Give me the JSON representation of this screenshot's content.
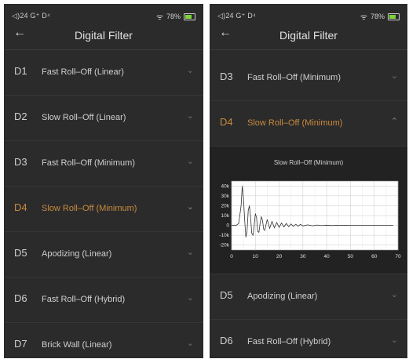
{
  "status": {
    "signal": "◁)24 G⁺ D⁴",
    "wifi_icon": "wifi-icon",
    "battery": "78%"
  },
  "header": {
    "back_icon": "←",
    "title": "Digital Filter"
  },
  "left_list": [
    {
      "code": "D1",
      "label": "Fast Roll–Off (Linear)",
      "active": false
    },
    {
      "code": "D2",
      "label": "Slow Roll–Off (Linear)",
      "active": false
    },
    {
      "code": "D3",
      "label": "Fast Roll–Off (Minimum)",
      "active": false
    },
    {
      "code": "D4",
      "label": "Slow Roll–Off (Minimum)",
      "active": true
    },
    {
      "code": "D5",
      "label": "Apodizing (Linear)",
      "active": false
    },
    {
      "code": "D6",
      "label": "Fast Roll–Off (Hybrid)",
      "active": false
    },
    {
      "code": "D7",
      "label": "Brick Wall (Linear)",
      "active": false
    }
  ],
  "right_list_top": [
    {
      "code": "D3",
      "label": "Fast Roll–Off (Minimum)",
      "active": false
    },
    {
      "code": "D4",
      "label": "Slow Roll–Off (Minimum)",
      "active": true
    }
  ],
  "right_list_bottom": [
    {
      "code": "D5",
      "label": "Apodizing (Linear)",
      "active": false
    },
    {
      "code": "D6",
      "label": "Fast Roll–Off (Hybrid)",
      "active": false
    }
  ],
  "chevrons": {
    "down": "⌄",
    "up": "⌃"
  },
  "chart_data": {
    "type": "line",
    "title": "Slow Roll–Off (Minimum)",
    "xlabel": "",
    "ylabel": "",
    "xlim": [
      0,
      70
    ],
    "ylim": [
      -25000,
      45000
    ],
    "xticks": [
      0,
      10,
      20,
      30,
      40,
      50,
      60,
      70
    ],
    "xtick_labels": [
      "0",
      "10",
      "20",
      "30",
      "40",
      "50",
      "60",
      "70"
    ],
    "yticks": [
      40000,
      30000,
      20000,
      10000,
      0,
      -10000,
      -20000
    ],
    "ytick_labels": [
      "40k",
      "30k",
      "20k",
      "10k",
      "0",
      "-10k",
      "-20k"
    ],
    "grid": true,
    "series": [
      {
        "x": [
          0,
          1,
          2,
          3,
          4,
          4.5,
          5,
          5.5,
          6,
          6.5,
          7,
          7.5,
          8,
          8.5,
          9,
          9.5,
          10,
          10.5,
          11,
          11.5,
          12,
          12.5,
          13,
          13.5,
          14,
          14.5,
          15,
          16,
          17,
          18,
          19,
          20,
          21,
          22,
          23,
          24,
          25,
          26,
          27,
          28,
          29,
          30,
          32,
          34,
          36,
          38,
          40,
          42,
          44,
          46,
          48,
          50,
          55,
          60,
          65,
          68
        ],
        "y": [
          0,
          0,
          200,
          2000,
          20000,
          40000,
          28000,
          5000,
          -12000,
          -6000,
          15000,
          20000,
          8000,
          -8000,
          -10000,
          0,
          12000,
          8000,
          -6000,
          -7000,
          2000,
          9000,
          5000,
          -4000,
          -5000,
          1000,
          6000,
          -3000,
          4000,
          -2500,
          3000,
          -2000,
          2500,
          -1500,
          2000,
          -1200,
          1500,
          -1000,
          1200,
          -800,
          1000,
          -600,
          500,
          -400,
          350,
          -250,
          200,
          -150,
          100,
          -80,
          60,
          0,
          0,
          0,
          0,
          0
        ]
      }
    ]
  }
}
